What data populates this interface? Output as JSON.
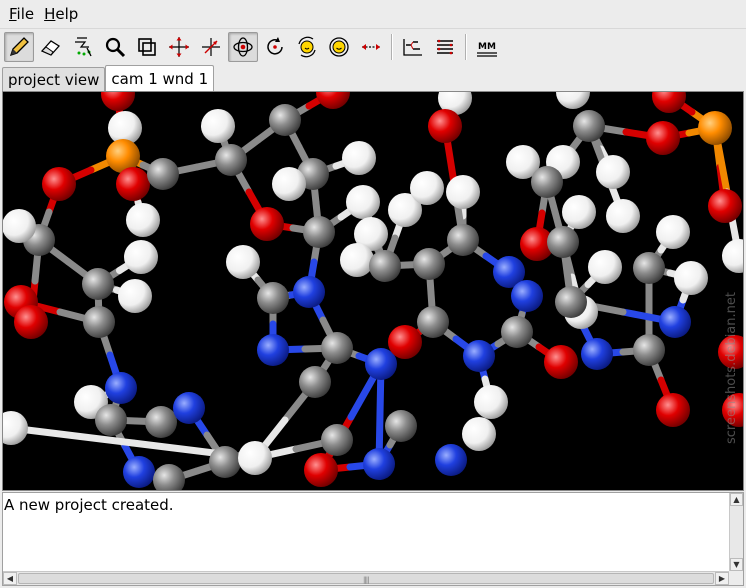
{
  "menu": {
    "file_rest": "ile",
    "file_mn": "F",
    "help_rest": "elp",
    "help_mn": "H"
  },
  "toolbar": {
    "tools": [
      "draw-pencil",
      "erase",
      "select",
      "zoom",
      "clipping",
      "translate",
      "translate-xy",
      "orbit-rotate",
      "rotate-z",
      "rotate-xy",
      "rotate-scene",
      "measure",
      "energy-plot",
      "dialog-list",
      "molecular-mechanics"
    ],
    "active_tool": "orbit-rotate",
    "mm_label": "MM"
  },
  "tabs": [
    {
      "label": "project view"
    },
    {
      "label": "cam 1 wnd 1"
    }
  ],
  "viewport": {
    "watermark": "screenshots.debian.net",
    "background": "#000000"
  },
  "log": {
    "message": "A new project created."
  },
  "colors": {
    "carbon": "#8c8c8c",
    "hydrogen": "#ffffff",
    "nitrogen": "#2040e0",
    "oxygen": "#e00000",
    "phosphorus": "#ff8c00"
  }
}
